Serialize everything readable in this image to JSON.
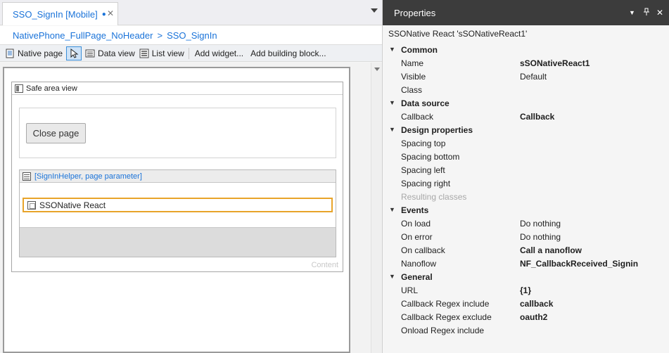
{
  "editor": {
    "tab": {
      "title": "SSO_SignIn [Mobile]",
      "modified_dot": "●",
      "close": "✕"
    },
    "breadcrumb": {
      "layout": "NativePhone_FullPage_NoHeader",
      "separator": ">",
      "page": "SSO_SignIn"
    },
    "toolbar": {
      "native_page": "Native page",
      "data_view": "Data view",
      "list_view": "List view",
      "add_widget": "Add widget...",
      "add_building_block": "Add building block..."
    },
    "canvas": {
      "safe_area_label": "Safe area view",
      "close_button": "Close page",
      "dataview_label": "[SignInHelper, page parameter]",
      "selected_widget": "SSONative React",
      "content_placeholder": "Content"
    }
  },
  "properties": {
    "title": "Properties",
    "controls": {
      "dropdown": "▼",
      "pin": "📌",
      "close": "✕"
    },
    "subtitle": "SSONative React 'sSONativeReact1'",
    "sections": [
      {
        "label": "Common",
        "rows": [
          {
            "name": "Name",
            "value": "sSONativeReact1",
            "bold": true
          },
          {
            "name": "Visible",
            "value": "Default",
            "bold": false
          },
          {
            "name": "Class",
            "value": "",
            "bold": false
          }
        ]
      },
      {
        "label": "Data source",
        "rows": [
          {
            "name": "Callback",
            "value": "Callback",
            "bold": true
          }
        ]
      },
      {
        "label": "Design properties",
        "rows": [
          {
            "name": "Spacing top",
            "value": "",
            "bold": false
          },
          {
            "name": "Spacing bottom",
            "value": "",
            "bold": false
          },
          {
            "name": "Spacing left",
            "value": "",
            "bold": false
          },
          {
            "name": "Spacing right",
            "value": "",
            "bold": false
          },
          {
            "name": "Resulting classes",
            "value": "",
            "bold": false,
            "dim": true
          }
        ]
      },
      {
        "label": "Events",
        "rows": [
          {
            "name": "On load",
            "value": "Do nothing",
            "bold": false
          },
          {
            "name": "On error",
            "value": "Do nothing",
            "bold": false
          },
          {
            "name": "On callback",
            "value": "Call a nanoflow",
            "bold": true
          },
          {
            "name": "Nanoflow",
            "value": "NF_CallbackReceived_Signin",
            "bold": true
          }
        ]
      },
      {
        "label": "General",
        "rows": [
          {
            "name": "URL",
            "value": "{1}",
            "bold": true
          },
          {
            "name": "Callback Regex include",
            "value": "callback",
            "bold": true
          },
          {
            "name": "Callback Regex exclude",
            "value": "oauth2",
            "bold": true
          },
          {
            "name": "Onload Regex include",
            "value": "",
            "bold": false
          }
        ]
      }
    ],
    "colors": {
      "titlebar": "#3c3c3c",
      "selection": "#e8a42a",
      "link": "#1a73d9"
    }
  }
}
